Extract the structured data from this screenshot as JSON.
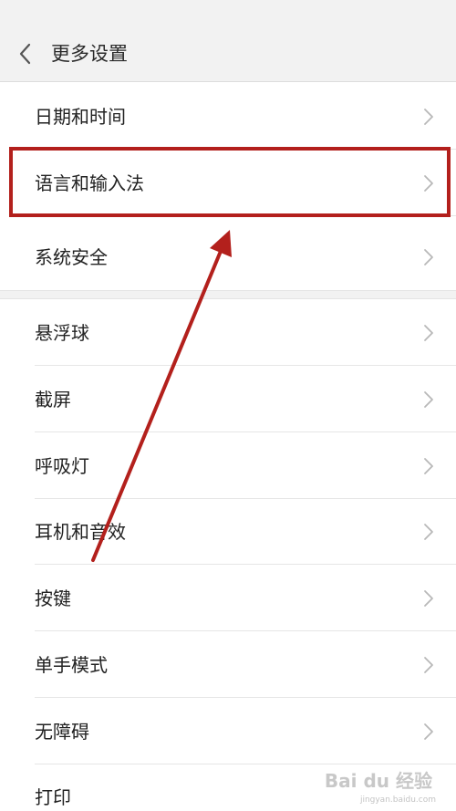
{
  "header": {
    "title": "更多设置",
    "back_icon": "chevron-left-icon"
  },
  "settings": {
    "items": [
      {
        "label": "日期和时间",
        "icon": "chevron-right-icon"
      },
      {
        "label": "语言和输入法",
        "icon": "chevron-right-icon",
        "highlighted": true
      },
      {
        "label": "系统安全",
        "icon": "chevron-right-icon"
      },
      {
        "label": "悬浮球",
        "icon": "chevron-right-icon"
      },
      {
        "label": "截屏",
        "icon": "chevron-right-icon"
      },
      {
        "label": "呼吸灯",
        "icon": "chevron-right-icon"
      },
      {
        "label": "耳机和音效",
        "icon": "chevron-right-icon"
      },
      {
        "label": "按键",
        "icon": "chevron-right-icon"
      },
      {
        "label": "单手模式",
        "icon": "chevron-right-icon"
      },
      {
        "label": "无障碍",
        "icon": "chevron-right-icon"
      },
      {
        "label": "打印",
        "icon": "chevron-right-icon"
      }
    ]
  },
  "annotation": {
    "color": "#b3201c"
  },
  "watermark": {
    "text": "Bai du 经验",
    "sub": "jingyan.baidu.com"
  },
  "colors": {
    "header_bg": "#f2f2f2",
    "divider": "#e6e6e6",
    "chevron": "#b8b8b8",
    "text": "#222222"
  }
}
